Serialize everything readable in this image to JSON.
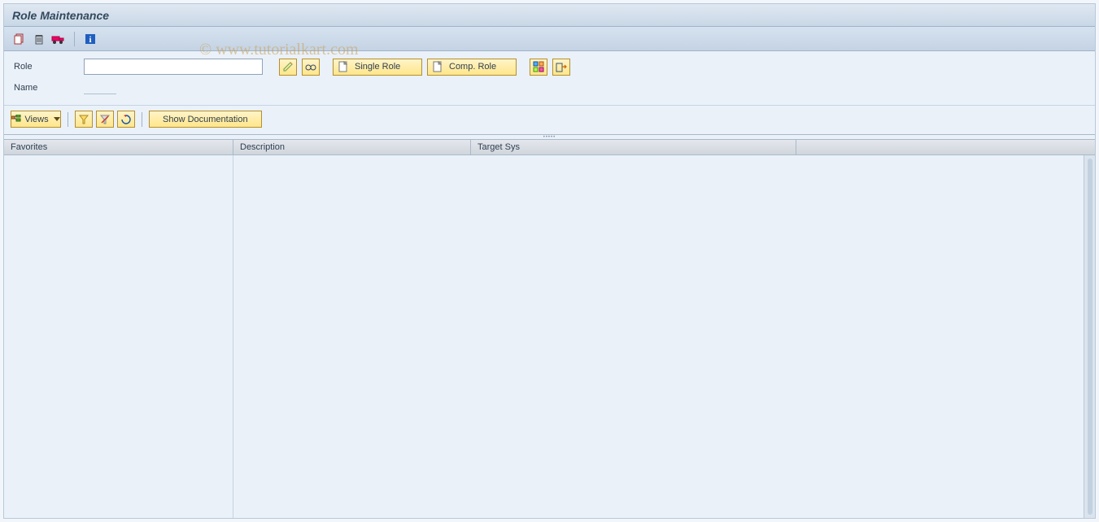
{
  "header": {
    "title": "Role Maintenance"
  },
  "watermark": "© www.tutorialkart.com",
  "toolbar": {
    "copy_icon": "copy",
    "delete_icon": "delete",
    "transport_icon": "transport",
    "info_icon": "info"
  },
  "form": {
    "role_label": "Role",
    "role_value": "",
    "name_label": "Name",
    "name_value": "",
    "edit_icon": "pencil",
    "display_icon": "glasses",
    "create_icon": "page",
    "single_role_label": "Single Role",
    "comp_role_label": "Comp. Role",
    "action1_icon": "grid-tools",
    "action2_icon": "export"
  },
  "lowbar": {
    "views_label": "Views",
    "filter_icon": "filter",
    "filter_del_icon": "filter-clear",
    "refresh_icon": "refresh",
    "show_doc_label": "Show Documentation"
  },
  "table": {
    "columns": {
      "c1": "Favorites",
      "c2": "Description",
      "c3": "Target Sys",
      "c4": ""
    },
    "rows": []
  }
}
